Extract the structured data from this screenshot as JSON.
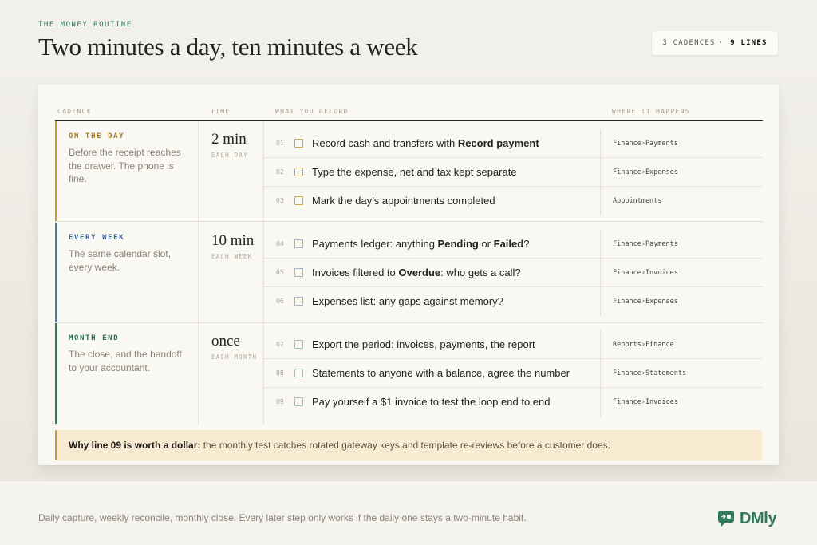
{
  "header": {
    "eyebrow": "THE MONEY ROUTINE",
    "title": "Two minutes a day, ten minutes a week",
    "badge_count": "3 CADENCES",
    "badge_sep": "·",
    "badge_lines": "9 LINES"
  },
  "columns": {
    "cadence": "CADENCE",
    "time": "TIME",
    "what": "WHAT YOU RECORD",
    "where": "WHERE IT HAPPENS"
  },
  "sections": [
    {
      "name": "ON THE DAY",
      "description": "Before the receipt reaches the drawer. The phone is fine.",
      "time": "2 min",
      "time_sub": "EACH DAY",
      "accent": "#c79a3a",
      "rows": [
        {
          "num": "01",
          "text_a": "Record cash and transfers with ",
          "bold1": "Record payment",
          "text_b": "",
          "bold2": "",
          "text_c": "",
          "where": "Finance›Payments"
        },
        {
          "num": "02",
          "text_a": "Type the expense, net and tax kept separate",
          "bold1": "",
          "text_b": "",
          "bold2": "",
          "text_c": "",
          "where": "Finance›Expenses"
        },
        {
          "num": "03",
          "text_a": "Mark the day’s appointments completed",
          "bold1": "",
          "text_b": "",
          "bold2": "",
          "text_c": "",
          "where": "Appointments"
        }
      ]
    },
    {
      "name": "EVERY WEEK",
      "description": "The same calendar slot, every week.",
      "time": "10 min",
      "time_sub": "EACH WEEK",
      "accent": "#4f78a8",
      "rows": [
        {
          "num": "04",
          "text_a": "Payments ledger: anything ",
          "bold1": "Pending",
          "text_b": " or ",
          "bold2": "Failed",
          "text_c": "?",
          "where": "Finance›Payments"
        },
        {
          "num": "05",
          "text_a": "Invoices filtered to ",
          "bold1": "Overdue",
          "text_b": ": who gets a call?",
          "bold2": "",
          "text_c": "",
          "where": "Finance›Invoices"
        },
        {
          "num": "06",
          "text_a": "Expenses list: any gaps against memory?",
          "bold1": "",
          "text_b": "",
          "bold2": "",
          "text_c": "",
          "where": "Finance›Expenses"
        }
      ]
    },
    {
      "name": "MONTH END",
      "description": "The close, and the handoff to your accountant.",
      "time": "once",
      "time_sub": "EACH MONTH",
      "accent": "#2e7a5a",
      "rows": [
        {
          "num": "07",
          "text_a": "Export the period: invoices, payments, the report",
          "bold1": "",
          "text_b": "",
          "bold2": "",
          "text_c": "",
          "where": "Reports›Finance"
        },
        {
          "num": "08",
          "text_a": "Statements to anyone with a balance, agree the number",
          "bold1": "",
          "text_b": "",
          "bold2": "",
          "text_c": "",
          "where": "Finance›Statements"
        },
        {
          "num": "09",
          "text_a": "Pay yourself a $1 invoice to test the loop end to end",
          "bold1": "",
          "text_b": "",
          "bold2": "",
          "text_c": "",
          "where": "Finance›Invoices"
        }
      ]
    }
  ],
  "note": {
    "lead": "Why line 09 is worth a dollar:",
    "body": " the monthly test catches rotated gateway keys and template re-reviews before a customer does."
  },
  "footer": {
    "text": "Daily capture, weekly reconcile, monthly close. Every later step only works if the daily one stays a two-minute habit.",
    "logo": "DMly"
  },
  "colors": {
    "day": "#c79a3a",
    "week": "#4f78a8",
    "month": "#2e7a5a",
    "day_check": "#d9a24a",
    "week_check": "#9bb4cc",
    "month_check": "#9cc3b0"
  }
}
